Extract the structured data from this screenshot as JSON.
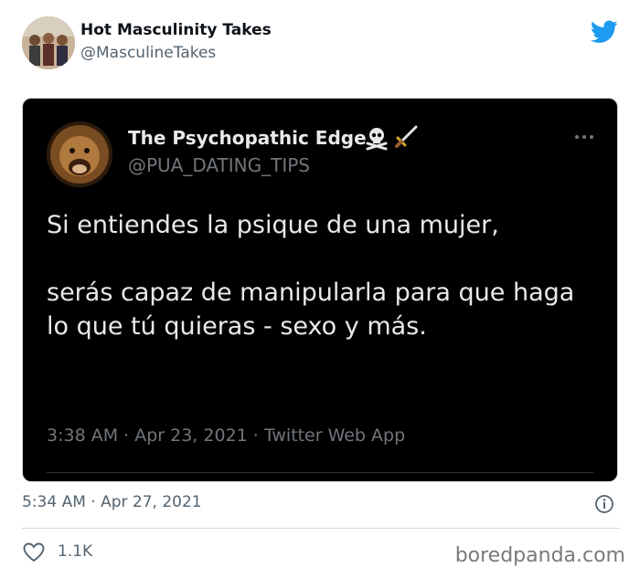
{
  "outer_tweet": {
    "author_name": "Hot Masculinity Takes",
    "author_handle": "@MasculineTakes",
    "timestamp": "5:34 AM · Apr 27, 2021",
    "likes": "1.1K"
  },
  "embedded_tweet": {
    "author_name": "The Psychopathic Edge",
    "author_handle": "@PUA_DATING_TIPS",
    "text_line1": "Si entiendes la psique de una mujer,",
    "text_line2": "serás capaz de manipularla para que haga",
    "text_line3": "lo que tú quieras - sexo y más.",
    "meta": "3:38 AM · Apr 23, 2021 · Twitter Web App"
  },
  "icons": {
    "brand": "twitter-bird-icon",
    "more": "more-options-icon",
    "info": "info-icon",
    "like": "heart-icon",
    "emoji_1": "skull-crossbones-icon",
    "emoji_2": "dagger-icon"
  },
  "colors": {
    "twitter_blue": "#1d9bf0",
    "embed_bg": "#000000",
    "secondary_text": "#536471"
  },
  "watermark": "boredpanda.com"
}
